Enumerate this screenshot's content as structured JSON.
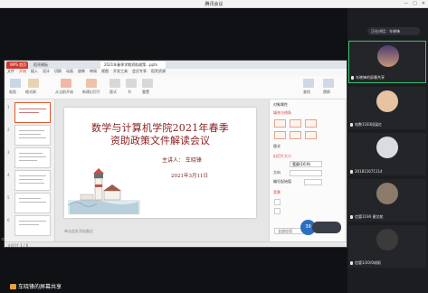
{
  "window": {
    "title": "腾讯会议"
  },
  "ppt": {
    "tabs": [
      "WPS 首页",
      "稻壳模板",
      "2021年春季学期资助政策...pptx"
    ],
    "menu": [
      "文件",
      "开始",
      "插入",
      "设计",
      "切换",
      "动画",
      "放映",
      "审阅",
      "视图",
      "开发工具",
      "会员专享",
      "稻壳资源"
    ],
    "menu_active_index": 1,
    "ribbon_labels": [
      "粘贴",
      "格式刷",
      "从当前开始",
      "新建幻灯片",
      "版式",
      "节",
      "重置",
      "查找",
      "替换"
    ],
    "slide_numbers": [
      "1",
      "2",
      "3",
      "4",
      "5",
      "6"
    ],
    "slide": {
      "title_line1": "数学与计算机学院2021年春季",
      "title_line2": "资助政策文件解读会议",
      "speaker": "主讲人：  车晓锋",
      "date": "2021年3月11日"
    },
    "notes_placeholder": "单击此处添加备注",
    "status": "幻灯片 1 / 6",
    "zoom_badge": "39",
    "right_panel": {
      "title": "对象属性",
      "section_fill": "填充与线条",
      "label_layout": "版式",
      "label_size": "幻灯片大小",
      "label_direction": "方向",
      "label_number": "编号起始值",
      "label_bg": "背景",
      "size_value": "宽屏(16:9)",
      "apply_all": "全部应用"
    }
  },
  "sidebar": {
    "speaking": "正在讲话：车晓锋",
    "participants": [
      {
        "name": "车晓锋的屏幕共享",
        "active": true,
        "avatar_color": "#6f5a86"
      },
      {
        "name": "电数1183班梁红",
        "active": false,
        "avatar_color": "#e6c3a1"
      },
      {
        "name": "201811671114",
        "active": false,
        "avatar_color": "#d9dde0"
      },
      {
        "name": "信管1194 谢文航",
        "active": false,
        "avatar_color": "#8c7a6a"
      },
      {
        "name": "信管1/20/0胡雨",
        "active": false,
        "avatar_color": "#3b3b3b"
      }
    ]
  },
  "screen_share_tag": "车晓锋的屏幕共享"
}
